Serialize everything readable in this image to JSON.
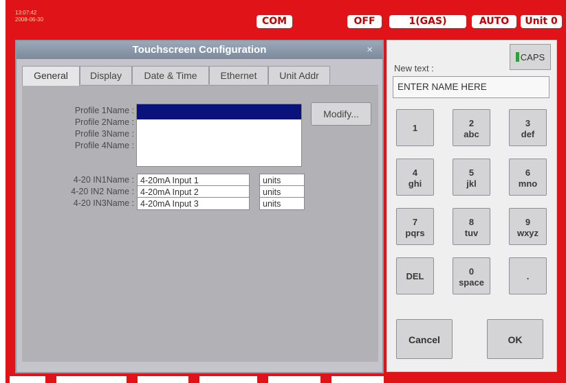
{
  "status": {
    "time": "13:07:42",
    "date": "2008-06-30",
    "com_label": "COM",
    "off_label": "OFF",
    "gas_label": "1(GAS)",
    "auto_label": "AUTO",
    "unit_label": "Unit 0"
  },
  "dialog": {
    "title": "Touchscreen Configuration",
    "close": "×",
    "tabs": [
      "General",
      "Display",
      "Date & Time",
      "Ethernet",
      "Unit Addr"
    ],
    "profile_labels": [
      "Profile 1Name :",
      "Profile 2Name :",
      "Profile 3Name :",
      "Profile 4Name :"
    ],
    "profile_values": [
      "",
      "",
      "",
      ""
    ],
    "modify_label": "Modify...",
    "input_labels": [
      "4-20 IN1Name :",
      "4-20 IN2 Name :",
      "4-20 IN3Name :"
    ],
    "input_names": [
      "4-20mA Input 1",
      "4-20mA Input 2",
      "4-20mA Input 3"
    ],
    "input_units": [
      "units",
      "units",
      "units"
    ]
  },
  "keypad": {
    "caps_label": "CAPS",
    "newtext_label": "New text :",
    "newtext_value": "ENTER NAME HERE",
    "keys": [
      {
        "main": "1",
        "sub": ""
      },
      {
        "main": "2",
        "sub": "abc"
      },
      {
        "main": "3",
        "sub": "def"
      },
      {
        "main": "4",
        "sub": "ghi"
      },
      {
        "main": "5",
        "sub": "jkl"
      },
      {
        "main": "6",
        "sub": "mno"
      },
      {
        "main": "7",
        "sub": "pqrs"
      },
      {
        "main": "8",
        "sub": "tuv"
      },
      {
        "main": "9",
        "sub": "wxyz"
      },
      {
        "main": "DEL",
        "sub": ""
      },
      {
        "main": "0",
        "sub": "space"
      },
      {
        "main": ".",
        "sub": ""
      }
    ],
    "cancel_label": "Cancel",
    "ok_label": "OK"
  },
  "colors": {
    "frame_red": "#e01418",
    "selection_blue": "#0a127c",
    "caps_led": "#2ea03a"
  }
}
